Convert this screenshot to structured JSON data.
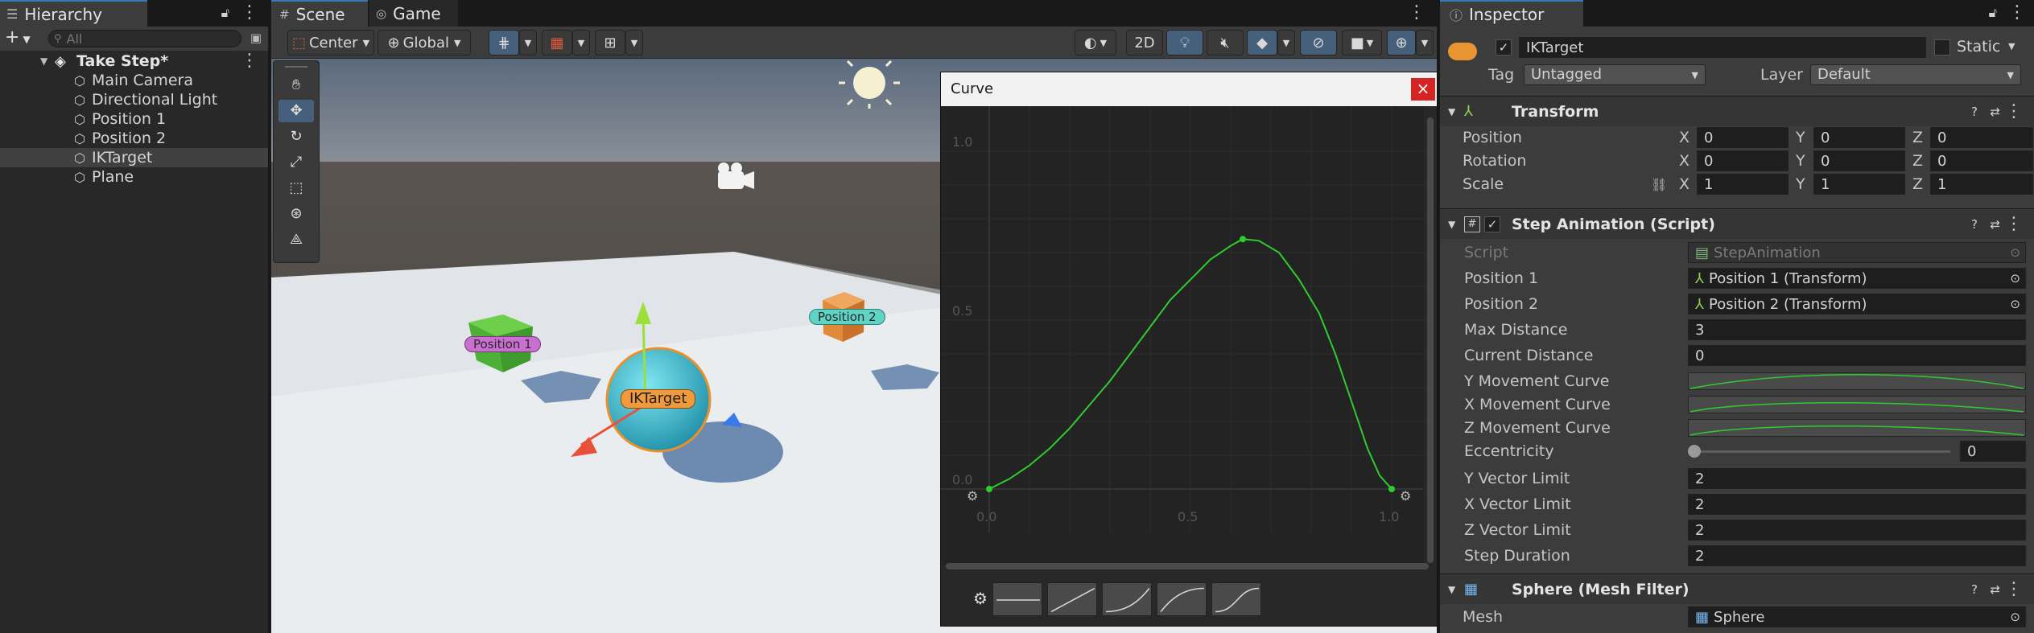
{
  "hierarchy": {
    "tab_label": "Hierarchy",
    "search_placeholder": "All",
    "add_label": "+",
    "scene_name": "Take Step*",
    "items": [
      {
        "label": "Main Camera"
      },
      {
        "label": "Directional Light"
      },
      {
        "label": "Position 1"
      },
      {
        "label": "Position 2"
      },
      {
        "label": "IKTarget",
        "selected": true
      },
      {
        "label": "Plane"
      }
    ]
  },
  "scene": {
    "tabs": [
      {
        "label": "Scene",
        "active": true
      },
      {
        "label": "Game",
        "active": false
      }
    ],
    "toolbar": {
      "pivot_label": "Center",
      "space_label": "Global",
      "mode_2d_label": "2D"
    },
    "tools": [
      "hand-tool",
      "move-tool",
      "rotate-tool",
      "scale-tool",
      "rect-tool",
      "transform-tool",
      "custom-tool"
    ],
    "labels": {
      "position1": "Position 1",
      "position2": "Position 2",
      "iktarget": "IKTarget"
    }
  },
  "curve_window": {
    "title": "Curve",
    "close_label": "×",
    "y_ticks": [
      "1.0",
      "0.5",
      "0.0"
    ],
    "x_ticks": [
      "0.0",
      "0.5",
      "1.0"
    ],
    "presets": [
      "constant",
      "linear",
      "ease-in",
      "ease-out",
      "ease-in-out"
    ],
    "curve_color": "#2ecc2e"
  },
  "inspector": {
    "tab_label": "Inspector",
    "object_name": "IKTarget",
    "static_label": "Static",
    "tag_label": "Tag",
    "tag_value": "Untagged",
    "layer_label": "Layer",
    "layer_value": "Default",
    "transform": {
      "header": "Transform",
      "position_label": "Position",
      "rotation_label": "Rotation",
      "scale_label": "Scale",
      "axis_x": "X",
      "axis_y": "Y",
      "axis_z": "Z",
      "position": [
        "0",
        "0",
        "0"
      ],
      "rotation": [
        "0",
        "0",
        "0"
      ],
      "scale": [
        "1",
        "1",
        "1"
      ]
    },
    "step_animation": {
      "header": "Step Animation (Script)",
      "script_label": "Script",
      "script_value": "StepAnimation",
      "position1_label": "Position 1",
      "position1_value": "Position 1 (Transform)",
      "position2_label": "Position 2",
      "position2_value": "Position 2 (Transform)",
      "max_distance_label": "Max Distance",
      "max_distance": "3",
      "current_distance_label": "Current Distance",
      "current_distance": "0",
      "y_curve_label": "Y Movement Curve",
      "x_curve_label": "X Movement Curve",
      "z_curve_label": "Z Movement Curve",
      "eccentricity_label": "Eccentricity",
      "eccentricity": "0",
      "eccentricity_fraction": 0,
      "y_limit_label": "Y Vector Limit",
      "y_limit": "2",
      "x_limit_label": "X Vector Limit",
      "x_limit": "2",
      "z_limit_label": "Z Vector Limit",
      "z_limit": "2",
      "step_duration_label": "Step Duration",
      "step_duration": "2"
    },
    "mesh_filter": {
      "header": "Sphere (Mesh Filter)",
      "mesh_label": "Mesh",
      "mesh_value": "Sphere"
    }
  }
}
